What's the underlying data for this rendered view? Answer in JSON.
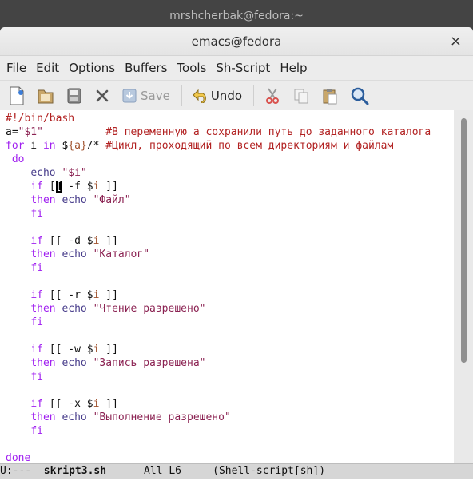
{
  "outer_title": "mrshcherbak@fedora:~",
  "window": {
    "title": "emacs@fedora",
    "close_glyph": "×"
  },
  "menubar": {
    "items": [
      "File",
      "Edit",
      "Options",
      "Buffers",
      "Tools",
      "Sh-Script",
      "Help"
    ]
  },
  "toolbar": {
    "save_label": "Save",
    "undo_label": "Undo",
    "icons": [
      "new-file-icon",
      "open-folder-icon",
      "save-disk-icon",
      "close-x-icon",
      "save-icon",
      "undo-icon",
      "cut-icon",
      "copy-icon",
      "paste-icon",
      "search-icon"
    ]
  },
  "editor": {
    "cursor_line": 6,
    "lines": [
      [
        {
          "t": "#!/bin/bash",
          "c": "cmt"
        }
      ],
      [
        {
          "t": "a=",
          "c": ""
        },
        {
          "t": "\"$1\"",
          "c": "str"
        },
        {
          "t": "          ",
          "c": ""
        },
        {
          "t": "#В переменную а сохранили путь до заданного каталога",
          "c": "cmt"
        }
      ],
      [
        {
          "t": "for",
          "c": "kw"
        },
        {
          "t": " i ",
          "c": ""
        },
        {
          "t": "in",
          "c": "kw"
        },
        {
          "t": " $",
          "c": ""
        },
        {
          "t": "{a}",
          "c": "var"
        },
        {
          "t": "/* ",
          "c": ""
        },
        {
          "t": "#Цикл, проходящий по всем директориям и файлам",
          "c": "cmt"
        }
      ],
      [
        {
          "t": " do",
          "c": "kw"
        }
      ],
      [
        {
          "t": "    ",
          "c": ""
        },
        {
          "t": "echo",
          "c": "bi"
        },
        {
          "t": " ",
          "c": ""
        },
        {
          "t": "\"$i\"",
          "c": "str"
        }
      ],
      [
        {
          "t": "    ",
          "c": ""
        },
        {
          "t": "if",
          "c": "kw"
        },
        {
          "t": " [",
          "c": ""
        },
        {
          "t": "[",
          "c": "cursor"
        },
        {
          "t": " -f $",
          "c": ""
        },
        {
          "t": "i",
          "c": "var"
        },
        {
          "t": " ]]",
          "c": ""
        }
      ],
      [
        {
          "t": "    ",
          "c": ""
        },
        {
          "t": "then",
          "c": "kw"
        },
        {
          "t": " ",
          "c": ""
        },
        {
          "t": "echo",
          "c": "bi"
        },
        {
          "t": " ",
          "c": ""
        },
        {
          "t": "\"Файл\"",
          "c": "str"
        }
      ],
      [
        {
          "t": "    ",
          "c": ""
        },
        {
          "t": "fi",
          "c": "kw"
        }
      ],
      [],
      [
        {
          "t": "    ",
          "c": ""
        },
        {
          "t": "if",
          "c": "kw"
        },
        {
          "t": " [[ -d $",
          "c": ""
        },
        {
          "t": "i",
          "c": "var"
        },
        {
          "t": " ]]",
          "c": ""
        }
      ],
      [
        {
          "t": "    ",
          "c": ""
        },
        {
          "t": "then",
          "c": "kw"
        },
        {
          "t": " ",
          "c": ""
        },
        {
          "t": "echo",
          "c": "bi"
        },
        {
          "t": " ",
          "c": ""
        },
        {
          "t": "\"Каталог\"",
          "c": "str"
        }
      ],
      [
        {
          "t": "    ",
          "c": ""
        },
        {
          "t": "fi",
          "c": "kw"
        }
      ],
      [],
      [
        {
          "t": "    ",
          "c": ""
        },
        {
          "t": "if",
          "c": "kw"
        },
        {
          "t": " [[ -r $",
          "c": ""
        },
        {
          "t": "i",
          "c": "var"
        },
        {
          "t": " ]]",
          "c": ""
        }
      ],
      [
        {
          "t": "    ",
          "c": ""
        },
        {
          "t": "then",
          "c": "kw"
        },
        {
          "t": " ",
          "c": ""
        },
        {
          "t": "echo",
          "c": "bi"
        },
        {
          "t": " ",
          "c": ""
        },
        {
          "t": "\"Чтение разрешено\"",
          "c": "str"
        }
      ],
      [
        {
          "t": "    ",
          "c": ""
        },
        {
          "t": "fi",
          "c": "kw"
        }
      ],
      [],
      [
        {
          "t": "    ",
          "c": ""
        },
        {
          "t": "if",
          "c": "kw"
        },
        {
          "t": " [[ -w $",
          "c": ""
        },
        {
          "t": "i",
          "c": "var"
        },
        {
          "t": " ]]",
          "c": ""
        }
      ],
      [
        {
          "t": "    ",
          "c": ""
        },
        {
          "t": "then",
          "c": "kw"
        },
        {
          "t": " ",
          "c": ""
        },
        {
          "t": "echo",
          "c": "bi"
        },
        {
          "t": " ",
          "c": ""
        },
        {
          "t": "\"Запись разрешена\"",
          "c": "str"
        }
      ],
      [
        {
          "t": "    ",
          "c": ""
        },
        {
          "t": "fi",
          "c": "kw"
        }
      ],
      [],
      [
        {
          "t": "    ",
          "c": ""
        },
        {
          "t": "if",
          "c": "kw"
        },
        {
          "t": " [[ -x $",
          "c": ""
        },
        {
          "t": "i",
          "c": "var"
        },
        {
          "t": " ]]",
          "c": ""
        }
      ],
      [
        {
          "t": "    ",
          "c": ""
        },
        {
          "t": "then",
          "c": "kw"
        },
        {
          "t": " ",
          "c": ""
        },
        {
          "t": "echo",
          "c": "bi"
        },
        {
          "t": " ",
          "c": ""
        },
        {
          "t": "\"Выполнение разрешено\"",
          "c": "str"
        }
      ],
      [
        {
          "t": "    ",
          "c": ""
        },
        {
          "t": "fi",
          "c": "kw"
        }
      ],
      [],
      [
        {
          "t": "done",
          "c": "kw"
        }
      ]
    ]
  },
  "modeline": {
    "status": "U:---  ",
    "buffer": "skript3.sh",
    "position": "      All L6     ",
    "mode": "(Shell-script[sh])"
  },
  "colors": {
    "keyword": "#a020f0",
    "string": "#8b2252",
    "comment": "#b22222",
    "variable": "#a0522d",
    "builtin": "#483d8b"
  }
}
